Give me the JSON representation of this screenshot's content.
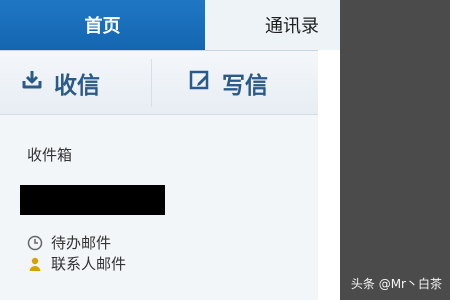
{
  "tabs": {
    "home": "首页",
    "contacts": "通讯录"
  },
  "actions": {
    "receive": "收信",
    "compose": "写信"
  },
  "sidebar": {
    "inbox": "收件箱",
    "todo_mail": "待办邮件",
    "contact_mail": "联系人邮件"
  },
  "watermark": "头条 @Mr丶白茶",
  "icons": {
    "receive": "download-icon",
    "compose": "edit-icon",
    "todo": "clock-icon",
    "contacts": "person-icon"
  },
  "colors": {
    "active_tab": "#1f77c4",
    "right_panel": "#4b4b4b",
    "action_text": "#2a5a8a"
  }
}
